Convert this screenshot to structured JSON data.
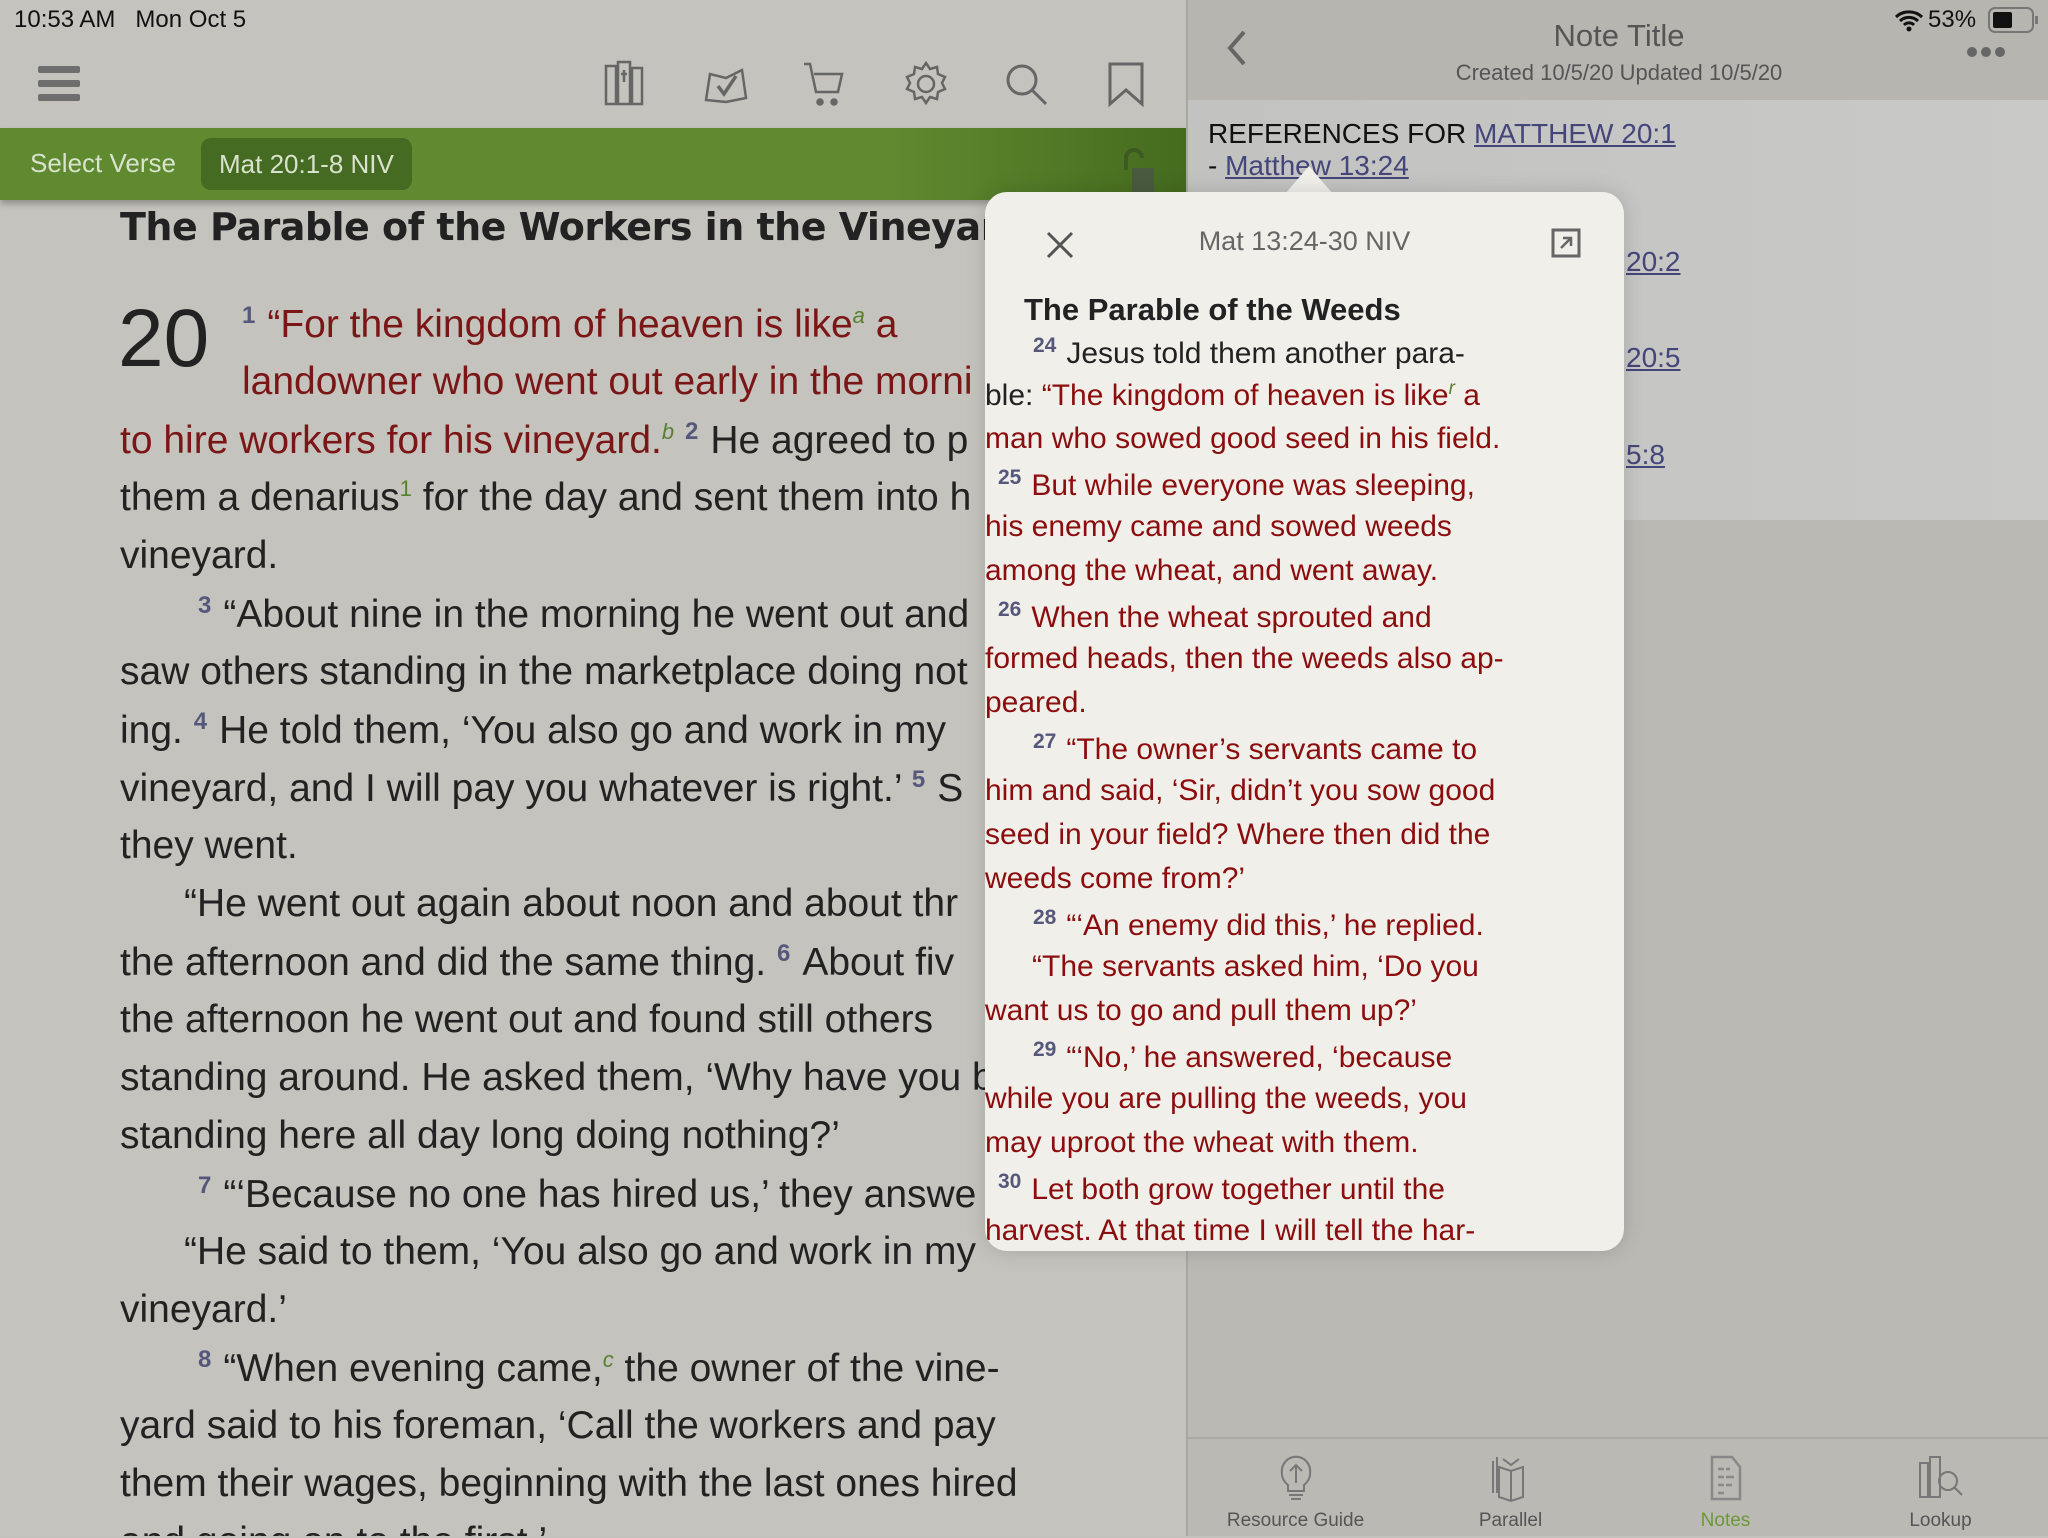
{
  "status": {
    "time": "10:53 AM",
    "date": "Mon Oct 5",
    "battery": "53%"
  },
  "toolbar": {
    "icons": [
      "menu-icon",
      "library-icon",
      "reading-plan-icon",
      "cart-icon",
      "gear-icon",
      "search-icon",
      "bookmark-icon"
    ]
  },
  "verse_bar": {
    "select_label": "Select Verse",
    "reference": "Mat 20:1-8 NIV"
  },
  "bible": {
    "heading": "The Parable of the Workers in the Vineyard",
    "chapter": "20",
    "lines": [
      {
        "indent": "first",
        "segs": [
          [
            "n",
            "1"
          ],
          [
            "r",
            "“For the kingdom of heaven is like"
          ],
          [
            "f",
            "a"
          ],
          [
            "r",
            " a"
          ]
        ]
      },
      {
        "indent": "first",
        "segs": [
          [
            "r",
            "landowner who went out early in the morni"
          ]
        ]
      },
      {
        "segs": [
          [
            "r",
            "to hire workers for his vineyard."
          ],
          [
            "f",
            "b"
          ],
          [
            "r",
            "  "
          ],
          [
            "n",
            "2"
          ],
          [
            "b",
            "He agreed to p"
          ]
        ]
      },
      {
        "segs": [
          [
            "b",
            "them a denarius"
          ],
          [
            "fn",
            "1"
          ],
          [
            "b",
            " for the day and sent them into h"
          ]
        ]
      },
      {
        "segs": [
          [
            "b",
            "vineyard."
          ]
        ]
      },
      {
        "indent": "para",
        "segs": [
          [
            "n",
            "3"
          ],
          [
            "b",
            "“About nine in the morning he went out and"
          ]
        ]
      },
      {
        "segs": [
          [
            "b",
            "saw others standing in the marketplace doing not"
          ]
        ]
      },
      {
        "segs": [
          [
            "b",
            "ing. "
          ],
          [
            "n",
            "4"
          ],
          [
            "b",
            "He told them, ‘You also go and work in my"
          ]
        ]
      },
      {
        "segs": [
          [
            "b",
            "vineyard, and I will pay you whatever is right.’ "
          ],
          [
            "n",
            "5"
          ],
          [
            "b",
            "S"
          ]
        ]
      },
      {
        "segs": [
          [
            "b",
            "they went."
          ]
        ]
      },
      {
        "indent": "half",
        "segs": [
          [
            "b",
            "“He went out again about noon and about thr"
          ]
        ]
      },
      {
        "segs": [
          [
            "b",
            "the afternoon and did the same thing. "
          ],
          [
            "n",
            "6"
          ],
          [
            "b",
            "About fiv"
          ]
        ]
      },
      {
        "segs": [
          [
            "b",
            "the afternoon he went out and found still others"
          ]
        ]
      },
      {
        "segs": [
          [
            "b",
            "standing around. He asked them, ‘Why have you b"
          ]
        ]
      },
      {
        "segs": [
          [
            "b",
            "standing here all day long doing nothing?’"
          ]
        ]
      },
      {
        "indent": "para",
        "segs": [
          [
            "n",
            "7"
          ],
          [
            "b",
            "“‘Because no one has hired us,’ they answe"
          ]
        ]
      },
      {
        "indent": "half",
        "segs": [
          [
            "b",
            "“He said to them, ‘You also go and work in my"
          ]
        ]
      },
      {
        "segs": [
          [
            "b",
            "vineyard.’"
          ]
        ]
      },
      {
        "indent": "para",
        "segs": [
          [
            "n",
            "8"
          ],
          [
            "b",
            "“When evening came,"
          ],
          [
            "f",
            "c"
          ],
          [
            "b",
            " the owner of the vine-"
          ]
        ]
      },
      {
        "segs": [
          [
            "b",
            "yard said to his foreman, ‘Call the workers and pay"
          ]
        ]
      },
      {
        "segs": [
          [
            "b",
            "them their wages, beginning with the last ones hired"
          ]
        ]
      },
      {
        "segs": [
          [
            "b",
            "and going on to the first.’"
          ]
        ]
      }
    ]
  },
  "note": {
    "title": "Note Title",
    "subtitle": "Created 10/5/20 Updated 10/5/20",
    "refs_label": "REFERENCES FOR ",
    "refs_link": "MATTHEW 20:1",
    "first_ref": "Matthew 13:24",
    "dash": "- ",
    "partial_refs": [
      "20:2",
      "20:5",
      "5:8"
    ]
  },
  "popup": {
    "title": "Mat 13:24-30 NIV",
    "heading": "The Parable of the Weeds",
    "lines": [
      {
        "indent": "para",
        "segs": [
          [
            "n",
            "24"
          ],
          [
            "b",
            "Jesus told them another para-"
          ]
        ]
      },
      {
        "segs": [
          [
            "b",
            "ble: "
          ],
          [
            "r",
            "“The kingdom of heaven is like"
          ],
          [
            "f",
            "r"
          ],
          [
            "r",
            " a"
          ]
        ]
      },
      {
        "segs": [
          [
            "r",
            "man who sowed good seed in his field."
          ]
        ]
      },
      {
        "indent": "small",
        "segs": [
          [
            "n",
            "25"
          ],
          [
            "r",
            "But while everyone was sleeping,"
          ]
        ]
      },
      {
        "segs": [
          [
            "r",
            "his enemy came and sowed weeds"
          ]
        ]
      },
      {
        "segs": [
          [
            "r",
            "among the wheat, and went away."
          ]
        ]
      },
      {
        "indent": "small",
        "segs": [
          [
            "n",
            "26"
          ],
          [
            "r",
            "When the wheat sprouted and"
          ]
        ]
      },
      {
        "segs": [
          [
            "r",
            "formed heads, then the weeds also ap-"
          ]
        ]
      },
      {
        "segs": [
          [
            "r",
            "peared."
          ]
        ]
      },
      {
        "indent": "para",
        "segs": [
          [
            "n",
            "27"
          ],
          [
            "r",
            "“The owner’s servants came to"
          ]
        ]
      },
      {
        "segs": [
          [
            "r",
            "him and said, ‘Sir, didn’t you sow good"
          ]
        ]
      },
      {
        "segs": [
          [
            "r",
            "seed in your field? Where then did the"
          ]
        ]
      },
      {
        "segs": [
          [
            "r",
            "weeds come from?’"
          ]
        ]
      },
      {
        "indent": "para",
        "segs": [
          [
            "n",
            "28"
          ],
          [
            "r",
            "“‘An enemy did this,’ he replied."
          ]
        ]
      },
      {
        "indent": "half",
        "segs": [
          [
            "r",
            "“The servants asked him, ‘Do you"
          ]
        ]
      },
      {
        "segs": [
          [
            "r",
            "want us to go and pull them up?’"
          ]
        ]
      },
      {
        "indent": "para",
        "segs": [
          [
            "n",
            "29"
          ],
          [
            "r",
            "“‘No,’ he answered, ‘because"
          ]
        ]
      },
      {
        "segs": [
          [
            "r",
            "while you are pulling the weeds, you"
          ]
        ]
      },
      {
        "segs": [
          [
            "r",
            "may uproot the wheat with them."
          ]
        ]
      },
      {
        "indent": "small",
        "segs": [
          [
            "n",
            "30"
          ],
          [
            "r",
            "Let both grow together until the"
          ]
        ]
      },
      {
        "segs": [
          [
            "r",
            "harvest. At that time I will tell the har-"
          ]
        ]
      }
    ]
  },
  "tabs": [
    {
      "label": "Resource Guide",
      "icon": "lightbulb-icon"
    },
    {
      "label": "Parallel",
      "icon": "parallel-books-icon"
    },
    {
      "label": "Notes",
      "icon": "notes-icon",
      "active": true
    },
    {
      "label": "Lookup",
      "icon": "lookup-icon"
    }
  ],
  "colors": {
    "accent_green": "#5f8a30",
    "words_of_christ": "#8b0d0d",
    "link": "#44457a",
    "active_tab": "#6a9a36"
  }
}
